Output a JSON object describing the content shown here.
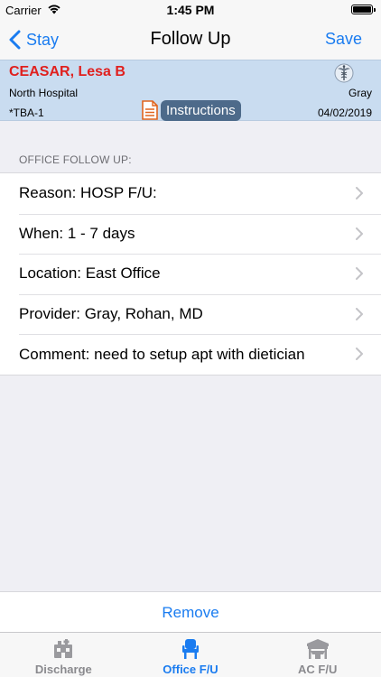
{
  "status_bar": {
    "carrier": "Carrier",
    "time": "1:45 PM"
  },
  "nav": {
    "back_label": "Stay",
    "title": "Follow Up",
    "save_label": "Save"
  },
  "patient": {
    "name": "CEASAR, Lesa B",
    "hospital": "North Hospital",
    "provider": "Gray",
    "room": "*TBA-1",
    "date": "04/02/2019",
    "instructions_label": "Instructions"
  },
  "section": {
    "header": "OFFICE FOLLOW UP:",
    "rows": [
      {
        "label": "Reason: HOSP F/U:"
      },
      {
        "label": "When: 1 - 7 days"
      },
      {
        "label": "Location: East Office"
      },
      {
        "label": "Provider: Gray, Rohan, MD"
      },
      {
        "label": "Comment: need to setup apt with dietician"
      }
    ]
  },
  "remove_label": "Remove",
  "tabs": [
    {
      "label": "Discharge",
      "icon": "discharge-icon",
      "active": false
    },
    {
      "label": "Office F/U",
      "icon": "office-chair-icon",
      "active": true
    },
    {
      "label": "AC F/U",
      "icon": "ac-facility-icon",
      "active": false
    }
  ],
  "colors": {
    "accent": "#1a7cf0",
    "patient_name": "#e0201e",
    "banner_bg": "#c9dcf0",
    "instructions_bg": "#4d6a8a",
    "doc_icon": "#e0641e",
    "inactive_tab": "#8a8a8e"
  }
}
